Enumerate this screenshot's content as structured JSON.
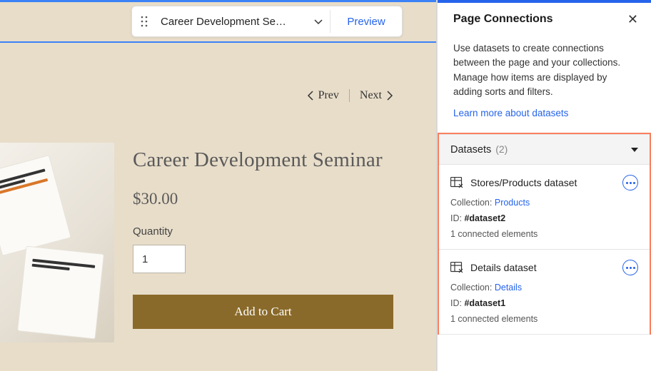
{
  "toolbar": {
    "page_name": "Career Development Se…",
    "preview_label": "Preview"
  },
  "prev_next": {
    "prev": "Prev",
    "next": "Next"
  },
  "product": {
    "title": "Career Development Seminar",
    "price": "$30.00",
    "qty_label": "Quantity",
    "qty_value": "1",
    "add_to_cart": "Add to Cart"
  },
  "panel": {
    "title": "Page Connections",
    "description": "Use datasets to create connections between the page and your collections. Manage how items are displayed by adding sorts and filters.",
    "learn_link": "Learn more about datasets",
    "datasets_header": "Datasets",
    "datasets_count": "(2)",
    "collection_label": "Collection:",
    "id_label": "ID:",
    "items": [
      {
        "name": "Stores/Products dataset",
        "collection": "Products",
        "id": "#dataset2",
        "connected": "1 connected elements"
      },
      {
        "name": "Details dataset",
        "collection": "Details",
        "id": "#dataset1",
        "connected": "1 connected elements"
      }
    ]
  }
}
